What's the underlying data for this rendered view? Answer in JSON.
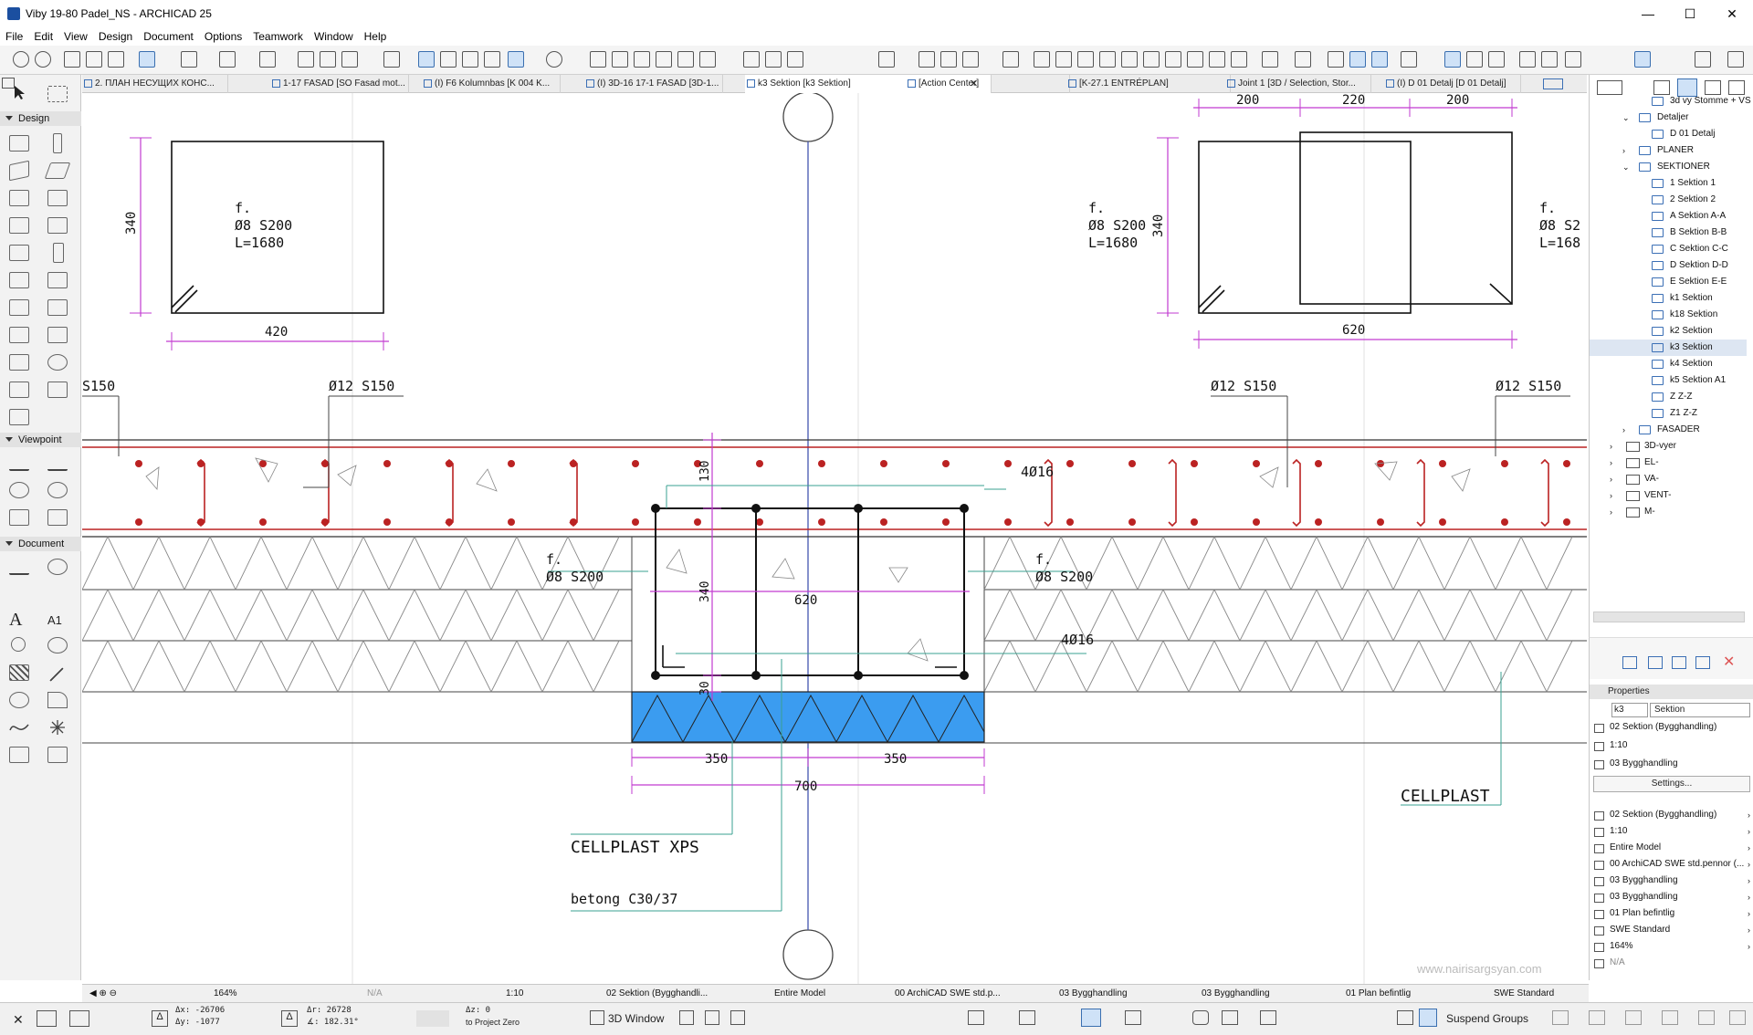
{
  "app": {
    "title": "Viby 19-80 Padel_NS - ARCHICAD 25",
    "minimize": "—",
    "maximize": "☐",
    "close": "✕"
  },
  "menu": [
    "File",
    "Edit",
    "View",
    "Design",
    "Document",
    "Options",
    "Teamwork",
    "Window",
    "Help"
  ],
  "tabs": [
    {
      "label": "2. ПЛАН НЕСУЩИХ КОНС..."
    },
    {
      "label": "1-17 FASAD [SO Fasad mot..."
    },
    {
      "label": "(I) F6 Kolumnbas [K 004 K..."
    },
    {
      "label": "(I) 3D-16 17-1 FASAD [3D-1..."
    },
    {
      "label": "k3 Sektion [k3 Sektion]"
    },
    {
      "label": "[Action Center]"
    },
    {
      "label": "[K-27.1 ENTRÉPLAN]"
    },
    {
      "label": "Joint 1 [3D / Selection, Stor..."
    },
    {
      "label": "(I) D 01 Detalj [D 01 Detalj]"
    }
  ],
  "toolbox": {
    "design": "Design",
    "viewpoint": "Viewpoint",
    "document": "Document",
    "text_tool": "A",
    "label_tool": "A1"
  },
  "drawing": {
    "tl_note": [
      "f.",
      "Ø8 S200",
      "L=1680"
    ],
    "tl_dim_v": "340",
    "tl_dim_h": "420",
    "tr_note": [
      "f.",
      "Ø8 S200",
      "L=1680"
    ],
    "tr_dim_v": "340",
    "tr_dim_h": "620",
    "tr_top_dims": [
      "200",
      "220",
      "200"
    ],
    "tr_note2": [
      "f.",
      "Ø8 S2",
      "L=168"
    ],
    "label_s150_left": "S150",
    "label_d12_1": "Ø12 S150",
    "label_d12_2": "Ø12 S150",
    "label_d12_3": "Ø12 S150",
    "beam_dim_130": "130",
    "beam_dim_340": "340",
    "beam_dim_620": "620",
    "beam_dim_30": "30",
    "bars_top": "4Ø16",
    "bars_bottom": "4Ø16",
    "stirrup_left": [
      "f.",
      "Ø8 S200"
    ],
    "stirrup_right": [
      "f.",
      "Ø8 S200"
    ],
    "dim_350a": "350",
    "dim_350b": "350",
    "dim_700": "700",
    "cellplast_xps": "CELLPLAST XPS",
    "betong": "betong C30/37",
    "cellplast": "CELLPLAST",
    "watermark": "www.nairisargsyan.com"
  },
  "navigator": {
    "items": [
      {
        "label": "3d vy Stomme + VS",
        "indent": 2,
        "kind": "view"
      },
      {
        "label": "Detaljer",
        "indent": 1,
        "kind": "view",
        "open": true
      },
      {
        "label": "D 01 Detalj",
        "indent": 2,
        "kind": "view"
      },
      {
        "label": "PLANER",
        "indent": 1,
        "kind": "view"
      },
      {
        "label": "SEKTIONER",
        "indent": 1,
        "kind": "view",
        "open": true
      },
      {
        "label": "1 Sektion 1",
        "indent": 2,
        "kind": "view"
      },
      {
        "label": "2 Sektion 2",
        "indent": 2,
        "kind": "view"
      },
      {
        "label": "A Sektion A-A",
        "indent": 2,
        "kind": "view"
      },
      {
        "label": "B Sektion B-B",
        "indent": 2,
        "kind": "view"
      },
      {
        "label": "C Sektion C-C",
        "indent": 2,
        "kind": "view"
      },
      {
        "label": "D Sektion D-D",
        "indent": 2,
        "kind": "view"
      },
      {
        "label": "E Sektion E-E",
        "indent": 2,
        "kind": "view"
      },
      {
        "label": "k1 Sektion",
        "indent": 2,
        "kind": "view"
      },
      {
        "label": "k18 Sektion",
        "indent": 2,
        "kind": "view"
      },
      {
        "label": "k2 Sektion",
        "indent": 2,
        "kind": "view"
      },
      {
        "label": "k3 Sektion",
        "indent": 2,
        "kind": "view",
        "selected": true
      },
      {
        "label": "k4 Sektion",
        "indent": 2,
        "kind": "view"
      },
      {
        "label": "k5 Sektion A1",
        "indent": 2,
        "kind": "view"
      },
      {
        "label": "Z Z-Z",
        "indent": 2,
        "kind": "view"
      },
      {
        "label": "Z1 Z-Z",
        "indent": 2,
        "kind": "view"
      },
      {
        "label": "FASADER",
        "indent": 1,
        "kind": "view"
      },
      {
        "label": "3D-vyer",
        "indent": 0,
        "kind": "folder"
      },
      {
        "label": "EL-",
        "indent": 0,
        "kind": "folder"
      },
      {
        "label": "VA-",
        "indent": 0,
        "kind": "folder"
      },
      {
        "label": "VENT-",
        "indent": 0,
        "kind": "folder"
      },
      {
        "label": "M-",
        "indent": 0,
        "kind": "folder"
      }
    ]
  },
  "properties": {
    "header": "Properties",
    "id": "k3",
    "name": "Sektion",
    "layer": "02 Sektion (Bygghandling)",
    "scale": "1:10",
    "set": "03 Bygghandling",
    "settings": "Settings...",
    "rows": [
      "02 Sektion (Bygghandling)",
      "1:10",
      "Entire Model",
      "00 ArchiCAD SWE std.pennor (...",
      "03 Bygghandling",
      "03 Bygghandling",
      "01 Plan befintlig",
      "SWE Standard",
      "164%",
      "N/A"
    ]
  },
  "statusbar": {
    "zoom": "164%",
    "angle": "N/A",
    "scale": "1:10",
    "layer_combo": "02 Sektion (Bygghandli...",
    "model": "Entire Model",
    "pen": "00 ArchiCAD SWE std.p...",
    "dim": "03 Bygghandling",
    "markup": "03 Bygghandling",
    "renov": "01 Plan befintlig",
    "std": "SWE Standard"
  },
  "coords": {
    "dx": "Δx: -26706",
    "dy": "Δy: -1077",
    "dr": "Δr: 26728",
    "da": "∡: 182.31°",
    "dz": "Δz: 0",
    "ref": "to Project Zero"
  },
  "bottom": {
    "window3d": "3D Window",
    "suspend": "Suspend Groups"
  }
}
